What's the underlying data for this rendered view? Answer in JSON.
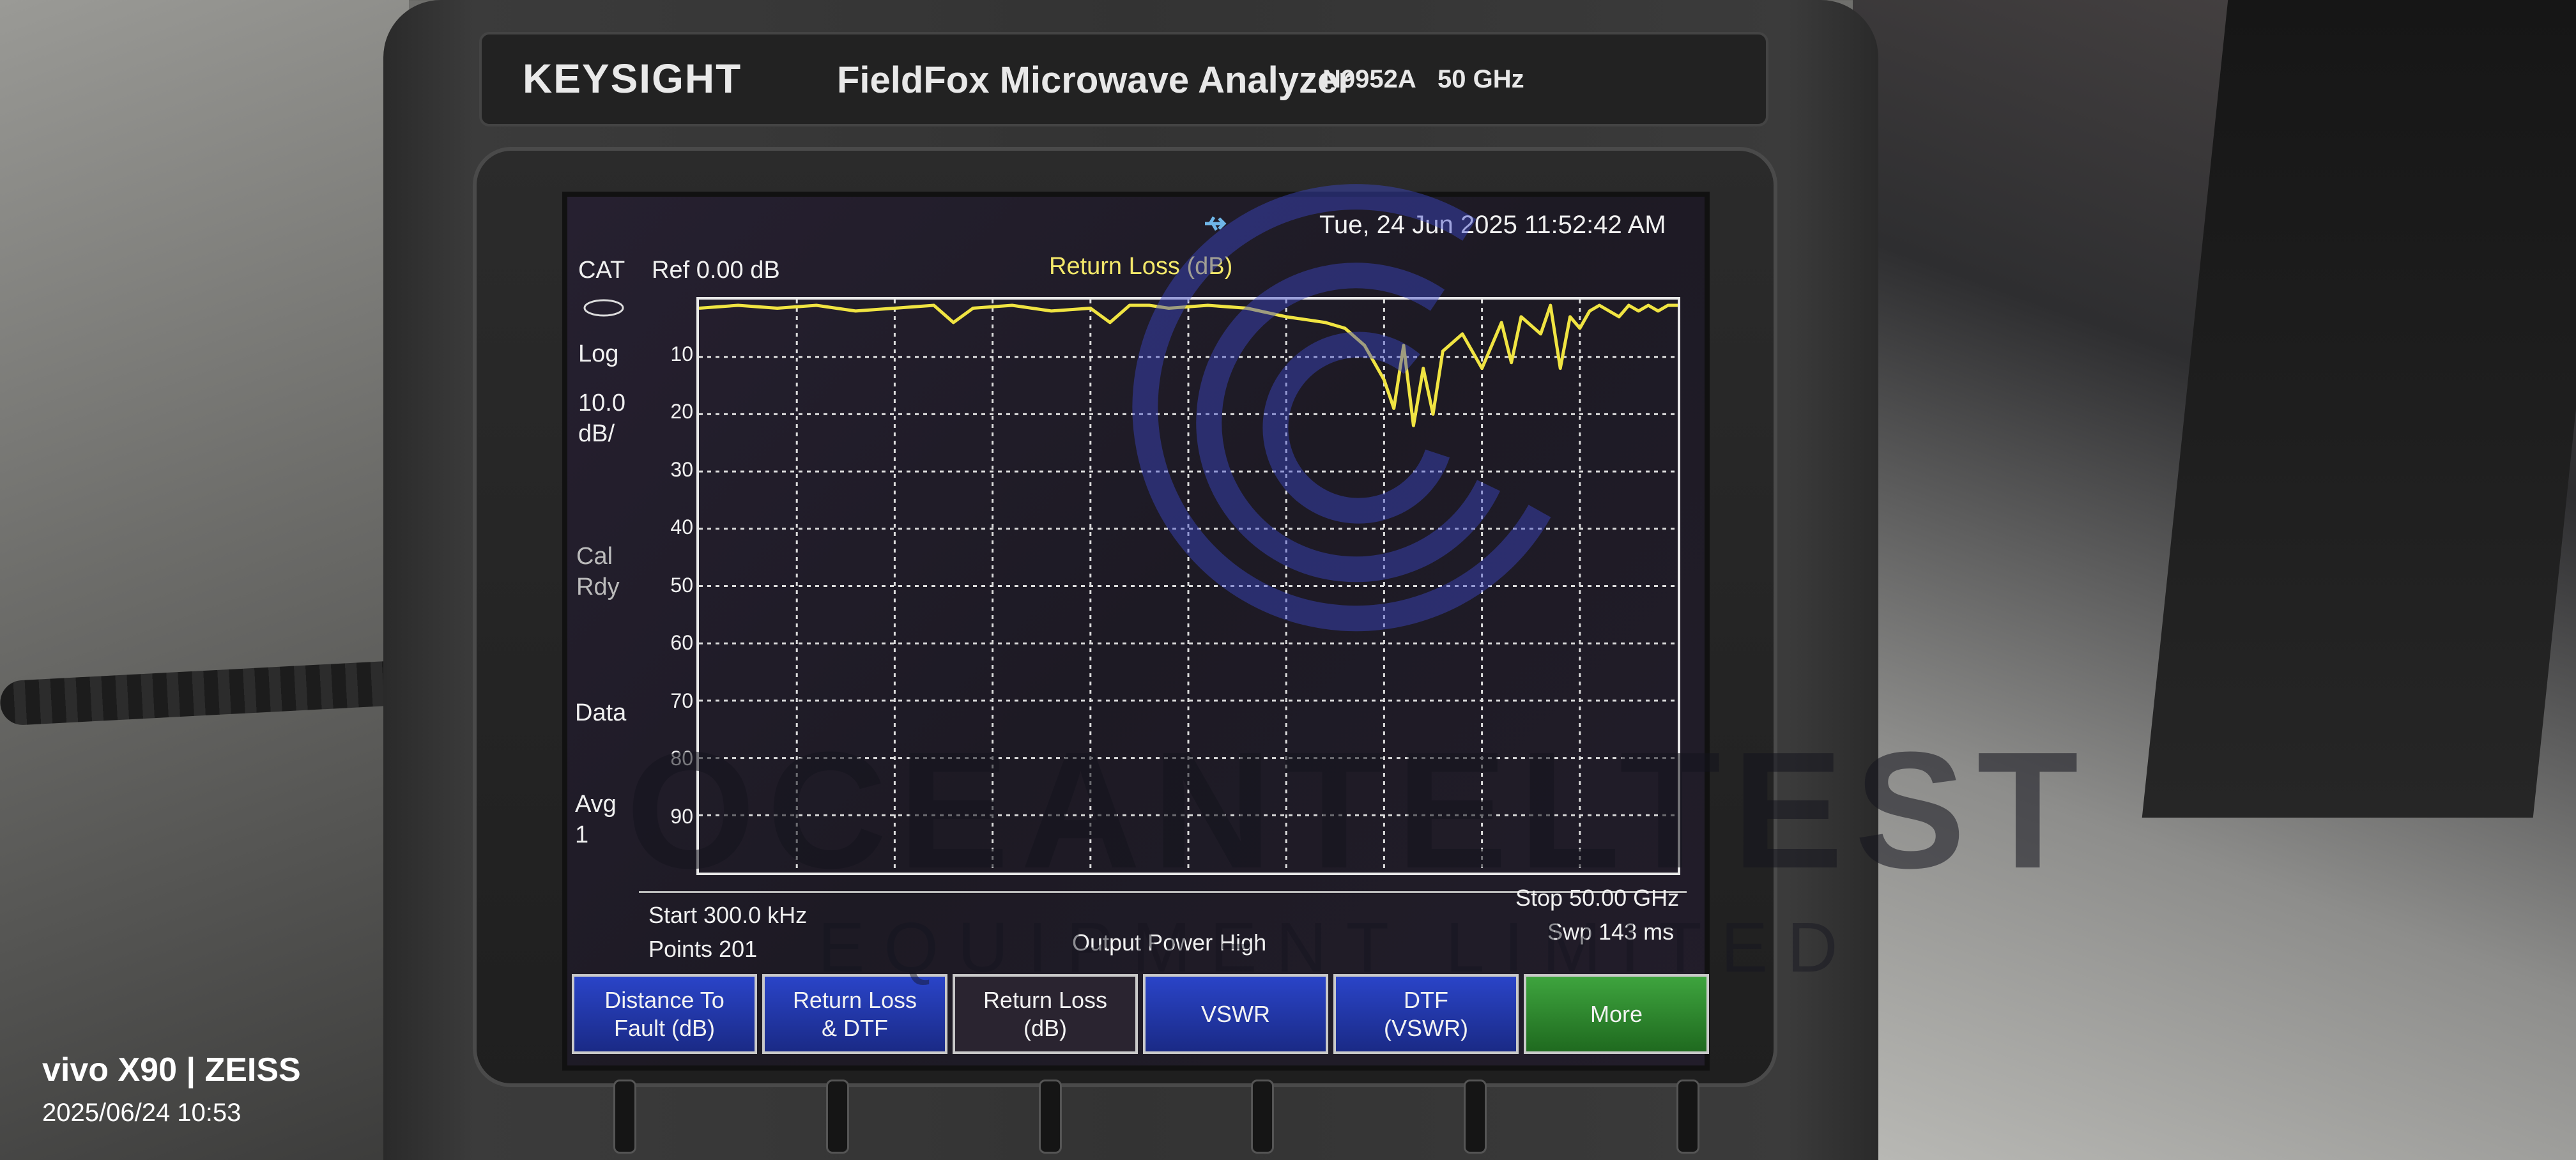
{
  "device": {
    "brand": "KEYSIGHT",
    "title": "FieldFox Microwave Analyzer",
    "model": "N9952A",
    "frequency": "50 GHz"
  },
  "status": {
    "datetime": "Tue, 24 Jun 2025 11:52:42 AM"
  },
  "left_panel": {
    "mode": "CAT",
    "scale_type": "Log",
    "scale_value": "10.0",
    "scale_unit": "dB/",
    "cal_line1": "Cal",
    "cal_line2": "Rdy",
    "data": "Data",
    "avg_label": "Avg",
    "avg_value": "1"
  },
  "trace_header": {
    "ref": "Ref 0.00 dB",
    "measurement": "Return Loss (dB)"
  },
  "chart_data": {
    "type": "line",
    "title": "Return Loss (dB)",
    "xlabel": "",
    "ylabel": "",
    "x_start": "Start 300.0 kHz",
    "x_stop": "Stop 50.00 GHz",
    "xlim_ghz": [
      0.0003,
      50.0
    ],
    "ylim_db": [
      0,
      100
    ],
    "y_reversed": true,
    "y_ticks": [
      "10",
      "20",
      "30",
      "40",
      "50",
      "60",
      "70",
      "80",
      "90"
    ],
    "grid": true,
    "series": [
      {
        "color": "#f0e442",
        "x_ghz": [
          0.0003,
          2,
          4,
          6,
          8,
          10,
          12,
          13,
          14,
          16,
          18,
          20,
          21,
          22,
          23,
          24,
          26,
          28,
          30,
          32,
          33,
          34,
          35,
          35.5,
          36,
          36.5,
          37,
          37.5,
          38,
          39,
          40,
          40.5,
          41,
          41.5,
          42,
          43,
          43.5,
          44,
          44.5,
          45,
          45.5,
          46,
          47,
          47.5,
          48,
          48.5,
          49,
          49.5,
          50
        ],
        "values_db": [
          1.5,
          1,
          1.5,
          1,
          2,
          1.5,
          1,
          4,
          1.5,
          1,
          2,
          1.5,
          4,
          1,
          1,
          1.5,
          1,
          1.5,
          3,
          4,
          5,
          8,
          14,
          19,
          8,
          22,
          12,
          20,
          9,
          6,
          12,
          8,
          4,
          11,
          3,
          6,
          1,
          12,
          3,
          5,
          2,
          1,
          3,
          1,
          2,
          1,
          2,
          1,
          1
        ]
      }
    ]
  },
  "footer": {
    "start": "Start 300.0 kHz",
    "points": "Points 201",
    "output_power": "Output Power High",
    "stop": "Stop 50.00 GHz",
    "sweep": "Swp 143 ms"
  },
  "softkeys": [
    {
      "label_line1": "Distance To",
      "label_line2": "Fault (dB)"
    },
    {
      "label_line1": "Return Loss",
      "label_line2": "& DTF"
    },
    {
      "label_line1": "Return Loss",
      "label_line2": "(dB)"
    },
    {
      "label_line1": "VSWR",
      "label_line2": ""
    },
    {
      "label_line1": "DTF",
      "label_line2": "(VSWR)"
    },
    {
      "label_line1": "More",
      "label_line2": ""
    }
  ],
  "colors": {
    "trace": "#f0e442",
    "softkey_blue": "#2a44c8",
    "softkey_green": "#3ea43e",
    "brand_red": "#e23b2e"
  },
  "watermark": {
    "text": "OCEANTELTEST",
    "sub": "EQUIPMENT LIMITED"
  },
  "camera": {
    "device": "vivo X90 | ZEISS",
    "timestamp": "2025/06/24 10:53"
  }
}
